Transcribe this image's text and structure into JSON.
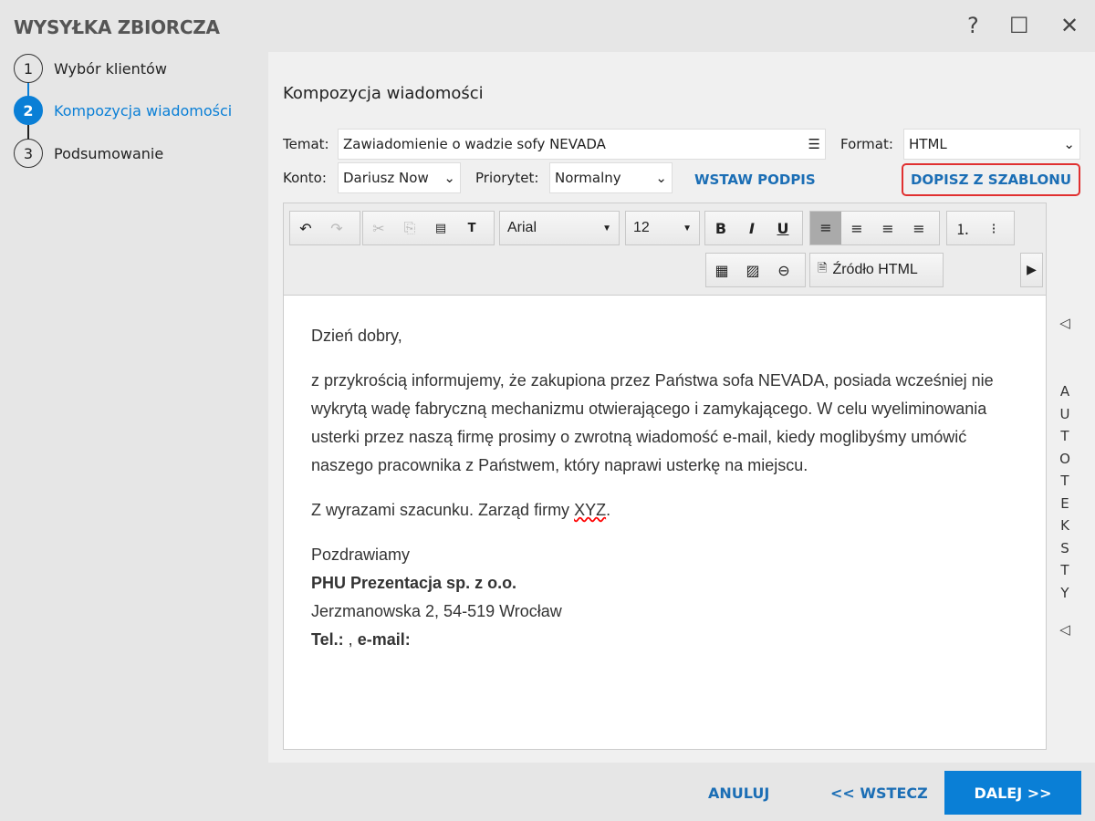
{
  "title": "WYSYŁKA ZBIORCZA",
  "window": {
    "help": "?",
    "maximize": "☐",
    "close": "✕"
  },
  "steps": [
    {
      "num": "1",
      "label": "Wybór klientów"
    },
    {
      "num": "2",
      "label": "Kompozycja wiadomości"
    },
    {
      "num": "3",
      "label": "Podsumowanie"
    }
  ],
  "section_title": "Kompozycja wiadomości",
  "form": {
    "temat_label": "Temat:",
    "temat_value": "Zawiadomienie o wadzie sofy NEVADA",
    "format_label": "Format:",
    "format_value": "HTML",
    "konto_label": "Konto:",
    "konto_value": "Dariusz Now",
    "priorytet_label": "Priorytet:",
    "priorytet_value": "Normalny",
    "wstaw_podpis": "WSTAW PODPIS",
    "dopisz_szablon": "DOPISZ Z SZABLONU"
  },
  "toolbar": {
    "font": "Arial",
    "size": "12",
    "source": "Źródło HTML",
    "undo": "↶",
    "redo": "↷",
    "cut": "✂",
    "copy": "⎘",
    "paste": "📋",
    "paste_text": "T",
    "bold": "B",
    "italic": "I",
    "underline": "U",
    "more": "▶"
  },
  "body": {
    "greeting": "Dzień dobry,",
    "para": "z przykrością informujemy, że zakupiona przez Państwa sofa NEVADA, posiada wcześniej nie wykrytą wadę fabryczną mechanizmu otwierającego i zamykającego. W celu wyeliminowania usterki przez naszą firmę prosimy o zwrotną wiadomość e-mail, kiedy moglibyśmy umówić naszego pracownika z Państwem, który naprawi usterkę na miejscu.",
    "regards_prefix": "Z wyrazami szacunku. Zarząd firmy ",
    "regards_xyz": "XYZ",
    "regards_suffix": ".",
    "sig1": "Pozdrawiamy",
    "sig2": "PHU Prezentacja sp. z o.o.",
    "sig3": "Jerzmanowska 2, 54-519 Wrocław",
    "sig4_tel": "Tel.:",
    "sig4_mid": " , ",
    "sig4_email": "e-mail:"
  },
  "autotexts": {
    "label": "AUTOTEKSTY",
    "arrow": "◁"
  },
  "footer": {
    "cancel": "ANULUJ",
    "back": "<< WSTECZ",
    "next": "DALEJ >>"
  }
}
